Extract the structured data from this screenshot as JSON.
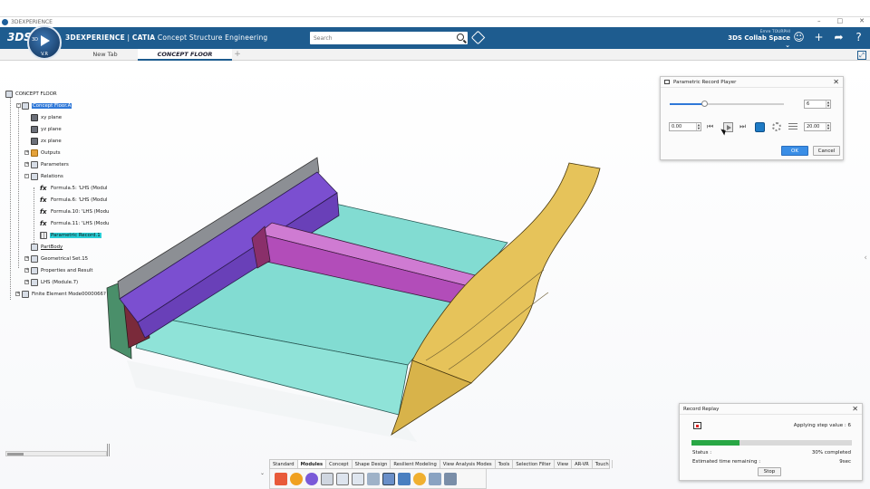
{
  "window": {
    "title": "3DEXPERIENCE",
    "controls": [
      "–",
      "□",
      "✕"
    ]
  },
  "header": {
    "brand_bold": "3DEXPERIENCE",
    "brand_sep": " | ",
    "brand_catia": "CATIA",
    "brand_app": " Concept Structure Engineering",
    "compass_version": "V.R",
    "compass_label": "3D",
    "logo": "3DS",
    "search_placeholder": "Search",
    "user_name": "Emre TOURPHI",
    "collab_space": "3DS Collab Space ⌄"
  },
  "tabs": [
    {
      "label": "New Tab"
    },
    {
      "label": "CONCEPT FLOOR"
    }
  ],
  "tab_add": "+",
  "tree": {
    "root": "CONCEPT FLOOR",
    "items": [
      {
        "label": "Concept Floor.A"
      },
      {
        "label": "xy plane"
      },
      {
        "label": "yz plane"
      },
      {
        "label": "zx plane"
      },
      {
        "label": "Outputs"
      },
      {
        "label": "Parameters"
      },
      {
        "label": "Relations"
      },
      {
        "label": "Formula.5: 'LHS (Modul"
      },
      {
        "label": "Formula.6: 'LHS (Modul"
      },
      {
        "label": "Formula.10: 'LHS (Modu"
      },
      {
        "label": "Formula.11: 'LHS (Modu"
      },
      {
        "label": "Parametric Record.1"
      },
      {
        "label": "PartBody"
      },
      {
        "label": "Geometrical Set.15"
      },
      {
        "label": "Properties and Result"
      },
      {
        "label": "LHS (Module.7)"
      },
      {
        "label": "Finite Element Mode0000066?"
      }
    ]
  },
  "record_player": {
    "title": "Parametric Record Player",
    "step_value": "6",
    "start_value": "0.00",
    "end_value": "20.00",
    "slider_fraction": 0.3,
    "ok_label": "OK",
    "cancel_label": "Cancel"
  },
  "record_replay": {
    "title": "Record Replay",
    "applying": "Applying step value : 6",
    "status_label": "Status :",
    "status_value": "30% completed",
    "progress_fraction": 0.3,
    "remaining_label": "Estimated time remaining :",
    "remaining_value": "9sec",
    "stop_label": "Stop"
  },
  "toolbar_tabs": [
    "Standard",
    "Modules",
    "Concept",
    "Shape Design",
    "Resilient Modeling",
    "View Analysis Modes",
    "Tools",
    "Selection Filter",
    "View",
    "AR-VR",
    "Touch"
  ],
  "colors": {
    "header": "#1e5c8f",
    "accent": "#2f78d8",
    "purple": "#7b4fd0",
    "magenta": "#b24db9",
    "cyan": "#82dcd2",
    "yellow": "#e6c35a",
    "green": "#28a745"
  }
}
